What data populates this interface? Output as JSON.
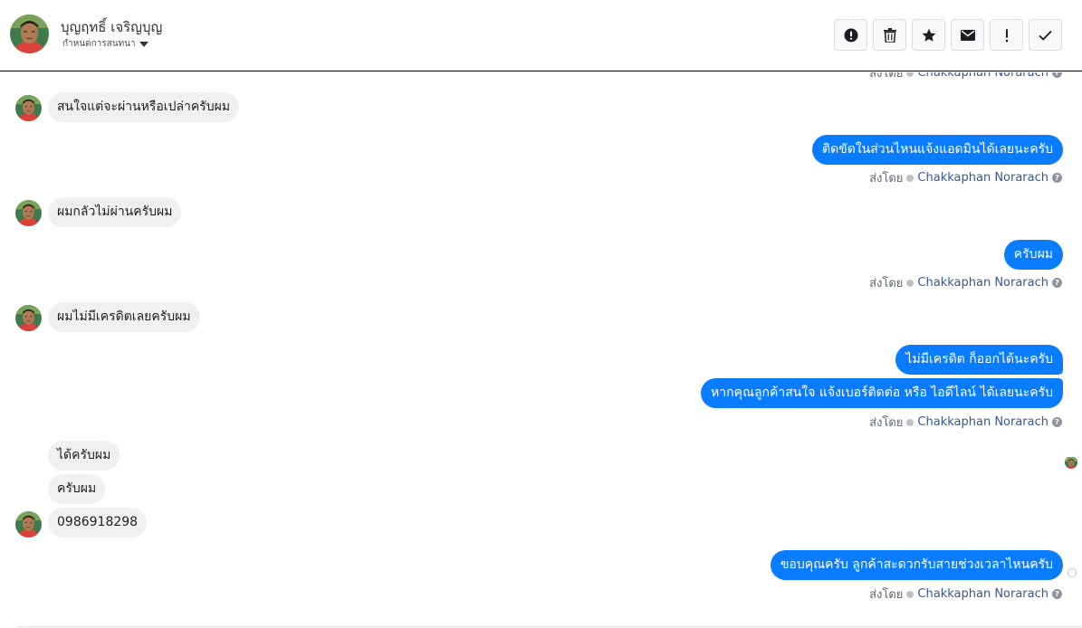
{
  "header": {
    "contact_name": "บุญฤทธิ์ เจริญบุญ",
    "assign_label": "กำหนดการสนทนา",
    "toolbar": [
      {
        "icon": "alert-circle-icon",
        "action": "mark-spam"
      },
      {
        "icon": "trash-icon",
        "action": "delete"
      },
      {
        "icon": "star-icon",
        "action": "follow-up"
      },
      {
        "icon": "envelope-icon",
        "action": "mark-unread"
      },
      {
        "icon": "exclamation-icon",
        "action": "important"
      },
      {
        "icon": "check-icon",
        "action": "done"
      }
    ]
  },
  "thread": {
    "partial_sender_line": {
      "prefix": "ส่งโดย",
      "name": "Chakkaphan Norarach"
    },
    "messages": [
      {
        "direction": "incoming",
        "text": "สนใจแต่จะผ่านหรือเปล่าครับผม"
      },
      {
        "direction": "outgoing",
        "text": "ติดขัดในส่วนไหนแจ้งแอดมินได้เลยนะครับ",
        "sender_prefix": "ส่งโดย",
        "sender_name": "Chakkaphan Norarach"
      },
      {
        "direction": "incoming",
        "text": "ผมกลัวไม่ผ่านครับผม"
      },
      {
        "direction": "outgoing",
        "text": "ครับผม",
        "sender_prefix": "ส่งโดย",
        "sender_name": "Chakkaphan Norarach"
      },
      {
        "direction": "incoming",
        "text": "ผมไม่มีเครดิตเลยครับผม"
      },
      {
        "direction": "outgoing",
        "text": "ไม่มีเครดิต ก็ออกได้นะครับ"
      },
      {
        "direction": "outgoing",
        "text": "หากคุณลูกค้าสนใจ แจ้งเบอร์ติดต่อ หรือ ไอดีไลน์ ได้เลยนะครับ",
        "sender_prefix": "ส่งโดย",
        "sender_name": "Chakkaphan Norarach"
      },
      {
        "direction": "incoming",
        "text": "ได้ครับผม"
      },
      {
        "direction": "incoming",
        "text": "ครับผม"
      },
      {
        "direction": "incoming",
        "text": "0986918298"
      },
      {
        "direction": "outgoing",
        "text": "ขอบคุณครับ ลูกค้าสะดวกรับสายช่วงเวลาไหนครับ",
        "sender_prefix": "ส่งโดย",
        "sender_name": "Chakkaphan Norarach"
      }
    ]
  },
  "colors": {
    "outgoing_bubble": "#0a7cff",
    "incoming_bubble": "#f0f0f0",
    "sender_link": "#365899"
  }
}
